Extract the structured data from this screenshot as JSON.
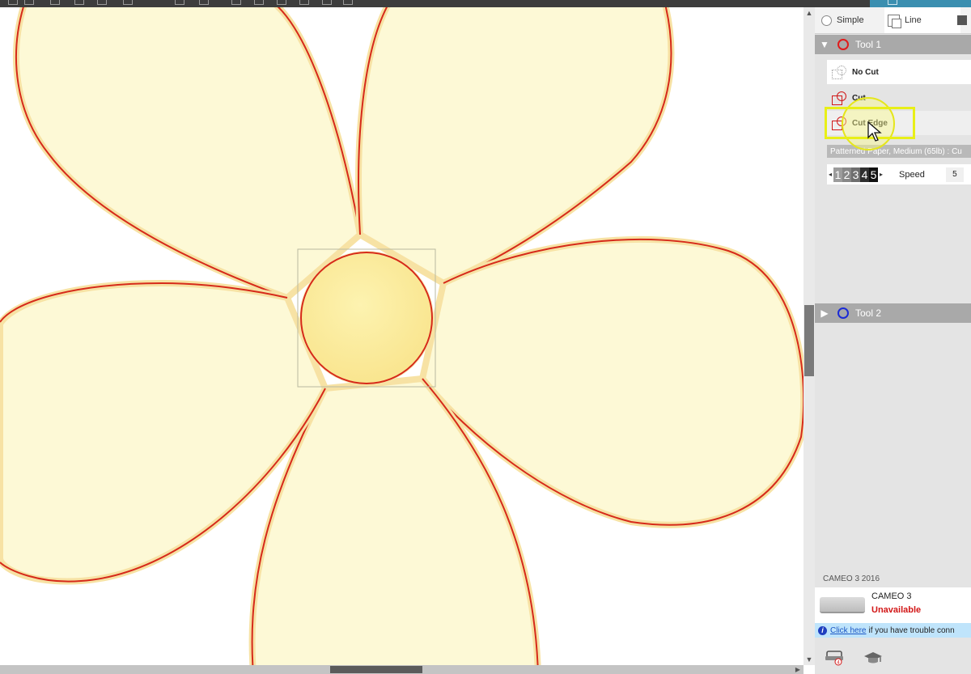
{
  "panel": {
    "tabs": {
      "simple": "Simple",
      "line": "Line"
    },
    "tool1": {
      "label": "Tool 1",
      "color": "#e01b1b"
    },
    "tool2": {
      "label": "Tool 2",
      "color": "#1b2bd6"
    },
    "cut_options": {
      "no_cut": "No Cut",
      "cut": "Cut",
      "cut_edge": "Cut Edge"
    },
    "material": "Patterned Paper, Medium (65lb) : Cu",
    "force_digits": [
      "1",
      "2",
      "3",
      "4",
      "5"
    ],
    "speed_label": "Speed",
    "speed_value": "5",
    "machine": {
      "section": "CAMEO 3 2016",
      "name": "CAMEO 3",
      "status": "Unavailable",
      "status_color": "#d21616"
    },
    "help": {
      "link": "Click here",
      "text": "if you have trouble conn"
    },
    "send_badge": "4"
  },
  "canvas": {
    "fill_color": "#fdf9d6",
    "outline_color": "#d62a1a",
    "center_color": "#fcf0a8"
  }
}
